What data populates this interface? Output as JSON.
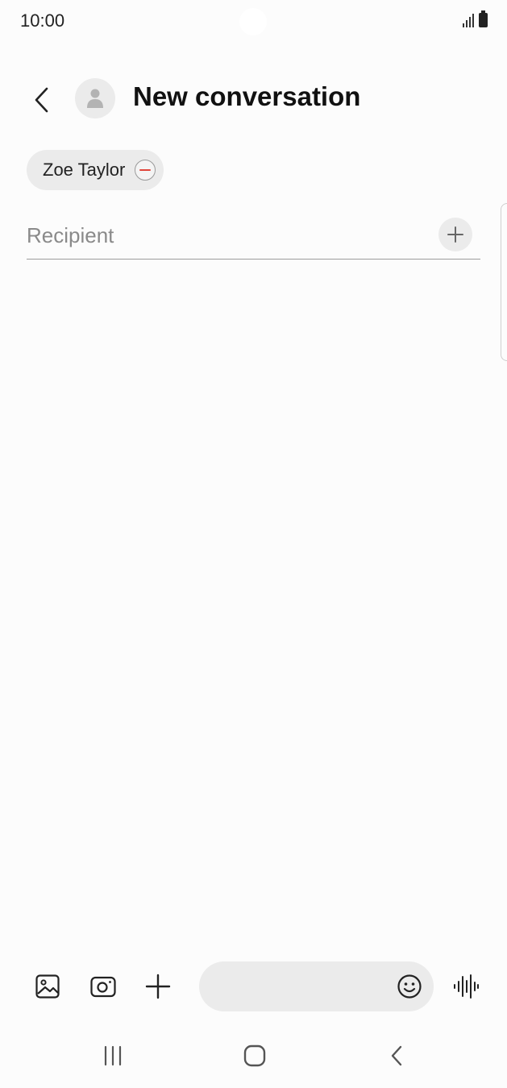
{
  "status_bar": {
    "time": "10:00",
    "icons": [
      "signal-icon",
      "battery-icon"
    ]
  },
  "header": {
    "back_icon": "chevron-left-icon",
    "avatar_icon": "person-icon",
    "title": "New conversation"
  },
  "recipients": {
    "chips": [
      {
        "label": "Zoe Taylor",
        "remove_icon": "minus-circle-icon"
      }
    ],
    "input_value": "",
    "placeholder": "Recipient",
    "add_icon": "plus-icon"
  },
  "composer": {
    "buttons": [
      "gallery-icon",
      "camera-icon",
      "plus-icon"
    ],
    "message_value": "",
    "message_placeholder": "",
    "emoji_icon": "emoji-icon",
    "voice_icon": "voice-waveform-icon"
  },
  "nav_bar": {
    "buttons": [
      "recents-icon",
      "home-icon",
      "back-icon"
    ]
  },
  "colors": {
    "background": "#fcfcfc",
    "chip_background": "#ebebeb",
    "remove_accent": "#e0453a",
    "text_primary": "#111111",
    "placeholder": "#8a8a8a"
  }
}
